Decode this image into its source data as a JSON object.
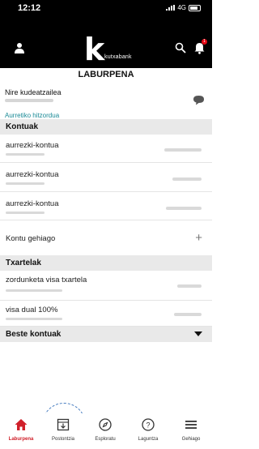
{
  "status_bar": {
    "time": "12:12",
    "network": "4G"
  },
  "header": {
    "brand": "kutxabank",
    "notification_count": "1"
  },
  "summary": {
    "title": "LABURPENA",
    "manager_label": "Nire kudeatzailea",
    "appointment_link": "Aurretiko hitzordua"
  },
  "accounts": {
    "section_title": "Kontuak",
    "items": [
      {
        "name": "aurrezki-kontua"
      },
      {
        "name": "aurrezki-kontua"
      },
      {
        "name": "aurrezki-kontua"
      }
    ],
    "more_label": "Kontu gehiago"
  },
  "cards": {
    "section_title": "Txartelak",
    "items": [
      {
        "name": "zordunketa visa txartela"
      },
      {
        "name": "visa dual 100%"
      }
    ]
  },
  "other_accounts": {
    "section_title": "Beste kontuak"
  },
  "tabbar": {
    "items": [
      {
        "label": "Laburpena",
        "icon": "home-icon",
        "active": true
      },
      {
        "label": "Postontzia",
        "icon": "inbox-icon",
        "active": false
      },
      {
        "label": "Esploratu",
        "icon": "compass-icon",
        "active": false
      },
      {
        "label": "Laguntza",
        "icon": "help-icon",
        "active": false
      },
      {
        "label": "Gehiago",
        "icon": "menu-icon",
        "active": false
      }
    ]
  },
  "colors": {
    "accent": "#d0202a",
    "link": "#1a8a96",
    "header_bg": "#000000",
    "section_bg": "#e9e9e9"
  }
}
